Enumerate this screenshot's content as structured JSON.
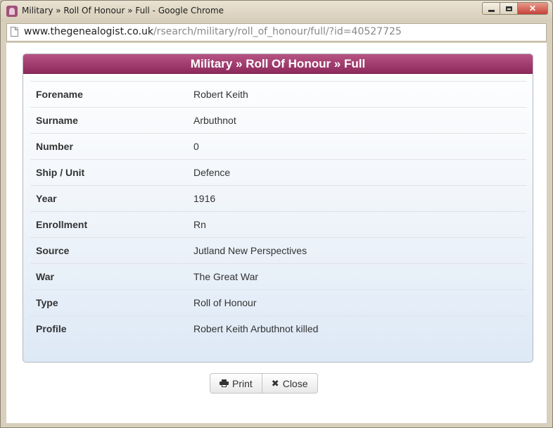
{
  "window": {
    "title": "Military » Roll Of Honour » Full - Google Chrome",
    "close_label": "✕"
  },
  "address": {
    "host": "www.thegenealogist.co.uk",
    "path": "/rsearch/military/roll_of_honour/full/?id=40527725"
  },
  "panel": {
    "title": "Military » Roll Of Honour » Full",
    "rows": [
      {
        "label": "Forename",
        "value": "Robert Keith"
      },
      {
        "label": "Surname",
        "value": "Arbuthnot"
      },
      {
        "label": "Number",
        "value": "0"
      },
      {
        "label": "Ship / Unit",
        "value": "Defence"
      },
      {
        "label": "Year",
        "value": "1916"
      },
      {
        "label": "Enrollment",
        "value": "Rn"
      },
      {
        "label": "Source",
        "value": "Jutland New Perspectives"
      },
      {
        "label": "War",
        "value": "The Great War"
      },
      {
        "label": "Type",
        "value": "Roll of Honour"
      },
      {
        "label": "Profile",
        "value": "Robert Keith Arbuthnot killed"
      }
    ]
  },
  "buttons": {
    "print_label": "Print",
    "close_label": "Close",
    "close_glyph": "✖"
  },
  "colors": {
    "header_top": "#b65484",
    "header_bottom": "#8e2a5c"
  }
}
